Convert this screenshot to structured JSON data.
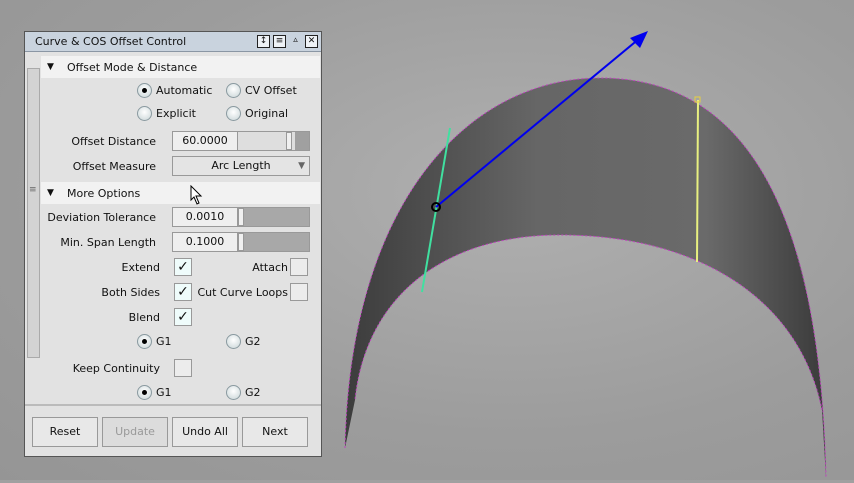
{
  "panel": {
    "title": "Curve & COS Offset Control",
    "title_icons": [
      "resize-icon",
      "menu-icon",
      "collapse-icon",
      "close-icon"
    ],
    "section1": {
      "label": "Offset Mode & Distance",
      "modes": {
        "automatic": "Automatic",
        "cv_offset": "CV Offset",
        "explicit": "Explicit",
        "original": "Original",
        "selected": "Automatic"
      },
      "offset_distance": {
        "label": "Offset Distance",
        "value": "60.0000"
      },
      "offset_measure": {
        "label": "Offset Measure",
        "value": "Arc Length"
      }
    },
    "section2": {
      "label": "More Options",
      "deviation_tolerance": {
        "label": "Deviation Tolerance",
        "value": "0.0010"
      },
      "min_span_length": {
        "label": "Min. Span Length",
        "value": "0.1000"
      },
      "extend": {
        "label": "Extend",
        "checked": true
      },
      "attach": {
        "label": "Attach",
        "checked": false
      },
      "both_sides": {
        "label": "Both Sides",
        "checked": true
      },
      "cut_curve_loops": {
        "label": "Cut Curve Loops",
        "checked": false
      },
      "blend": {
        "label": "Blend",
        "checked": true
      },
      "blend_g1": "G1",
      "blend_g2": "G2",
      "keep_continuity": {
        "label": "Keep Continuity",
        "checked": false
      },
      "keep_g1": "G1",
      "keep_g2": "G2",
      "check_mark": "✓"
    },
    "buttons": {
      "reset": "Reset",
      "update": "Update",
      "undo_all": "Undo All",
      "next": "Next"
    }
  },
  "colors": {
    "surface": "#5a5a5a",
    "green_curve": "#40e0a0",
    "yellow_curve": "#e8f080",
    "arrow": "#0000ee",
    "edge": "#c040c0"
  }
}
